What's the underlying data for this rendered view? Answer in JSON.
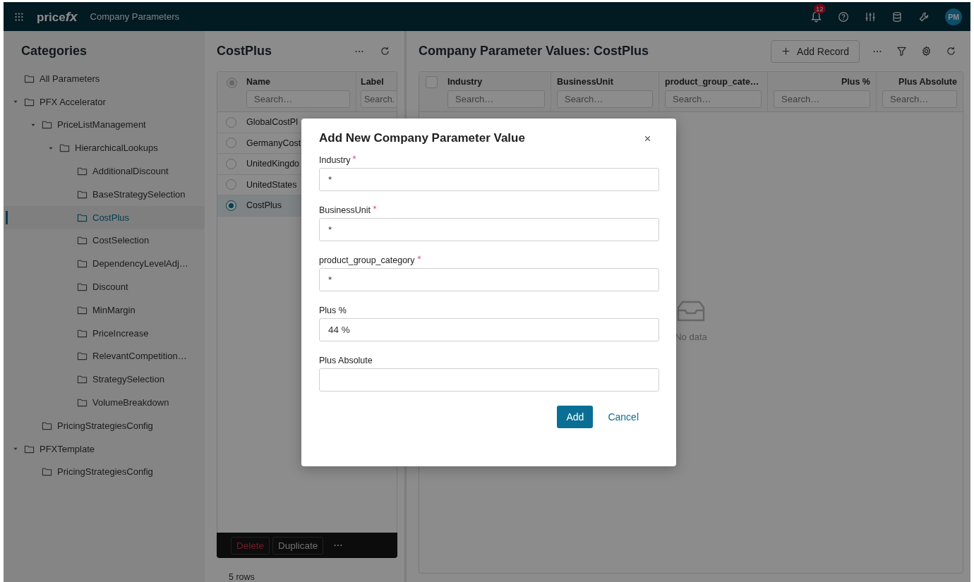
{
  "top_bar": {
    "logo": "price",
    "logo_mark": "fx",
    "title": "Company Parameters",
    "notification_count": "12",
    "avatar": "PM"
  },
  "categories": {
    "title": "Categories",
    "tree": [
      {
        "label": "All Parameters",
        "selected": false
      },
      {
        "label": "PFX Accelerator",
        "selected": false,
        "expanded": true,
        "children": [
          {
            "label": "PriceListManagement",
            "selected": false,
            "expanded": true,
            "children": [
              {
                "label": "HierarchicalLookups",
                "selected": false,
                "expanded": true,
                "children": [
                  {
                    "label": "AdditionalDiscount",
                    "selected": false
                  },
                  {
                    "label": "BaseStrategySelection",
                    "selected": false
                  },
                  {
                    "label": "CostPlus",
                    "selected": true
                  },
                  {
                    "label": "CostSelection",
                    "selected": false
                  },
                  {
                    "label": "DependencyLevelAdj…",
                    "selected": false
                  },
                  {
                    "label": "Discount",
                    "selected": false
                  },
                  {
                    "label": "MinMargin",
                    "selected": false
                  },
                  {
                    "label": "PriceIncrease",
                    "selected": false
                  },
                  {
                    "label": "RelevantCompetition…",
                    "selected": false
                  },
                  {
                    "label": "StrategySelection",
                    "selected": false
                  },
                  {
                    "label": "VolumeBreakdown",
                    "selected": false
                  }
                ]
              }
            ]
          },
          {
            "label": "PricingStrategiesConfig",
            "selected": false
          }
        ]
      },
      {
        "label": "PFXTemplate",
        "selected": false,
        "expanded": true,
        "children": [
          {
            "label": "PricingStrategiesConfig",
            "selected": false
          }
        ]
      }
    ]
  },
  "parameters": {
    "title": "CostPlus",
    "header_radio": {
      "selected": true,
      "disabled": true
    },
    "columns": [
      {
        "label": "Name",
        "placeholder": "Search…"
      },
      {
        "label": "Label",
        "placeholder": "Search."
      }
    ],
    "rows": [
      {
        "name": "GlobalCostPl",
        "selected": false
      },
      {
        "name": "GermanyCost",
        "selected": false
      },
      {
        "name": "UnitedKingdo",
        "selected": false
      },
      {
        "name": "UnitedStates",
        "selected": false
      },
      {
        "name": "CostPlus",
        "selected": true
      }
    ],
    "actions": [
      {
        "kind": "danger",
        "label": "Delete"
      },
      {
        "kind": "default",
        "label": "Duplicate"
      }
    ],
    "row_count": "5 rows"
  },
  "values": {
    "title": "Company Parameter Values: CostPlus",
    "add_button": "Add Record",
    "header_checkbox": {
      "checked": false
    },
    "columns": [
      {
        "label": "Industry",
        "placeholder": "Search…",
        "kind": "text"
      },
      {
        "label": "BusinessUnit",
        "placeholder": "Search…",
        "kind": "text"
      },
      {
        "label": "product_group_cate…",
        "placeholder": "Search…",
        "kind": "text"
      },
      {
        "label": "Plus %",
        "placeholder": "Search…",
        "kind": "number"
      },
      {
        "label": "Plus Absolute",
        "placeholder": "Search…",
        "kind": "number"
      }
    ],
    "empty_text": "No data"
  },
  "dialog": {
    "title": "Add New Company Parameter Value",
    "fields": [
      {
        "label": "Industry",
        "required": true,
        "value": "*"
      },
      {
        "label": "BusinessUnit",
        "required": true,
        "value": "*"
      },
      {
        "label": "product_group_category",
        "required": true,
        "value": "*"
      },
      {
        "label": "Plus %",
        "required": false,
        "value": "44 %"
      },
      {
        "label": "Plus Absolute",
        "required": false
      }
    ],
    "buttons": [
      {
        "kind": "primary",
        "label": "Add"
      },
      {
        "kind": "link",
        "label": "Cancel"
      }
    ]
  }
}
